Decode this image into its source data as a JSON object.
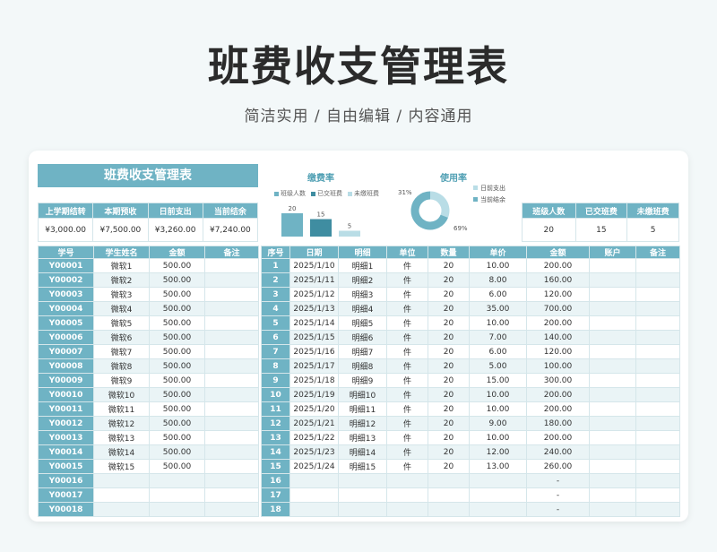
{
  "title": "班费收支管理表",
  "subtitle": "简洁实用 / 自由编辑 / 内容通用",
  "banner": "班费收支管理表",
  "summary_left": {
    "headers": [
      "上学期结转",
      "本期预收",
      "日前支出",
      "当前结余"
    ],
    "values": [
      "¥3,000.00",
      "¥7,500.00",
      "¥3,260.00",
      "¥7,240.00"
    ]
  },
  "summary_right": {
    "headers": [
      "班级人数",
      "已交班费",
      "未缴班费"
    ],
    "values": [
      "20",
      "15",
      "5"
    ]
  },
  "fee_chart": {
    "title": "缴费率",
    "legend": [
      "班级人数",
      "已交班费",
      "未缴班费"
    ],
    "colors": [
      "#6fb3c4",
      "#3f8da1",
      "#b9dde6"
    ]
  },
  "usage_chart": {
    "title": "使用率",
    "legend": [
      "日前支出",
      "当前结余"
    ],
    "colors": [
      "#b9dde6",
      "#6fb3c4"
    ]
  },
  "chart_data": [
    {
      "type": "bar",
      "title": "缴费率",
      "categories": [
        "班级人数",
        "已交班费",
        "未缴班费"
      ],
      "values": [
        20,
        15,
        5
      ]
    },
    {
      "type": "pie",
      "title": "使用率",
      "categories": [
        "日前支出",
        "当前结余"
      ],
      "values": [
        31,
        69
      ],
      "value_labels": [
        "31%",
        "69%"
      ]
    }
  ],
  "left_table": {
    "headers": [
      "学号",
      "学生姓名",
      "金额",
      "备注"
    ],
    "rows": [
      [
        "Y00001",
        "微软1",
        "500.00",
        ""
      ],
      [
        "Y00002",
        "微软2",
        "500.00",
        ""
      ],
      [
        "Y00003",
        "微软3",
        "500.00",
        ""
      ],
      [
        "Y00004",
        "微软4",
        "500.00",
        ""
      ],
      [
        "Y00005",
        "微软5",
        "500.00",
        ""
      ],
      [
        "Y00006",
        "微软6",
        "500.00",
        ""
      ],
      [
        "Y00007",
        "微软7",
        "500.00",
        ""
      ],
      [
        "Y00008",
        "微软8",
        "500.00",
        ""
      ],
      [
        "Y00009",
        "微软9",
        "500.00",
        ""
      ],
      [
        "Y00010",
        "微软10",
        "500.00",
        ""
      ],
      [
        "Y00011",
        "微软11",
        "500.00",
        ""
      ],
      [
        "Y00012",
        "微软12",
        "500.00",
        ""
      ],
      [
        "Y00013",
        "微软13",
        "500.00",
        ""
      ],
      [
        "Y00014",
        "微软14",
        "500.00",
        ""
      ],
      [
        "Y00015",
        "微软15",
        "500.00",
        ""
      ],
      [
        "Y00016",
        "",
        "",
        ""
      ],
      [
        "Y00017",
        "",
        "",
        ""
      ],
      [
        "Y00018",
        "",
        "",
        ""
      ]
    ]
  },
  "right_table": {
    "headers": [
      "序号",
      "日期",
      "明细",
      "单位",
      "数量",
      "单价",
      "金额",
      "账户",
      "备注"
    ],
    "rows": [
      [
        "1",
        "2025/1/10",
        "明细1",
        "件",
        "20",
        "10.00",
        "200.00",
        "",
        ""
      ],
      [
        "2",
        "2025/1/11",
        "明细2",
        "件",
        "20",
        "8.00",
        "160.00",
        "",
        ""
      ],
      [
        "3",
        "2025/1/12",
        "明细3",
        "件",
        "20",
        "6.00",
        "120.00",
        "",
        ""
      ],
      [
        "4",
        "2025/1/13",
        "明细4",
        "件",
        "20",
        "35.00",
        "700.00",
        "",
        ""
      ],
      [
        "5",
        "2025/1/14",
        "明细5",
        "件",
        "20",
        "10.00",
        "200.00",
        "",
        ""
      ],
      [
        "6",
        "2025/1/15",
        "明细6",
        "件",
        "20",
        "7.00",
        "140.00",
        "",
        ""
      ],
      [
        "7",
        "2025/1/16",
        "明细7",
        "件",
        "20",
        "6.00",
        "120.00",
        "",
        ""
      ],
      [
        "8",
        "2025/1/17",
        "明细8",
        "件",
        "20",
        "5.00",
        "100.00",
        "",
        ""
      ],
      [
        "9",
        "2025/1/18",
        "明细9",
        "件",
        "20",
        "15.00",
        "300.00",
        "",
        ""
      ],
      [
        "10",
        "2025/1/19",
        "明细10",
        "件",
        "20",
        "10.00",
        "200.00",
        "",
        ""
      ],
      [
        "11",
        "2025/1/20",
        "明细11",
        "件",
        "20",
        "10.00",
        "200.00",
        "",
        ""
      ],
      [
        "12",
        "2025/1/21",
        "明细12",
        "件",
        "20",
        "9.00",
        "180.00",
        "",
        ""
      ],
      [
        "13",
        "2025/1/22",
        "明细13",
        "件",
        "20",
        "10.00",
        "200.00",
        "",
        ""
      ],
      [
        "14",
        "2025/1/23",
        "明细14",
        "件",
        "20",
        "12.00",
        "240.00",
        "",
        ""
      ],
      [
        "15",
        "2025/1/24",
        "明细15",
        "件",
        "20",
        "13.00",
        "260.00",
        "",
        ""
      ],
      [
        "16",
        "",
        "",
        "",
        "",
        "",
        "-",
        "",
        ""
      ],
      [
        "17",
        "",
        "",
        "",
        "",
        "",
        "-",
        "",
        ""
      ],
      [
        "18",
        "",
        "",
        "",
        "",
        "",
        "-",
        "",
        ""
      ]
    ]
  }
}
